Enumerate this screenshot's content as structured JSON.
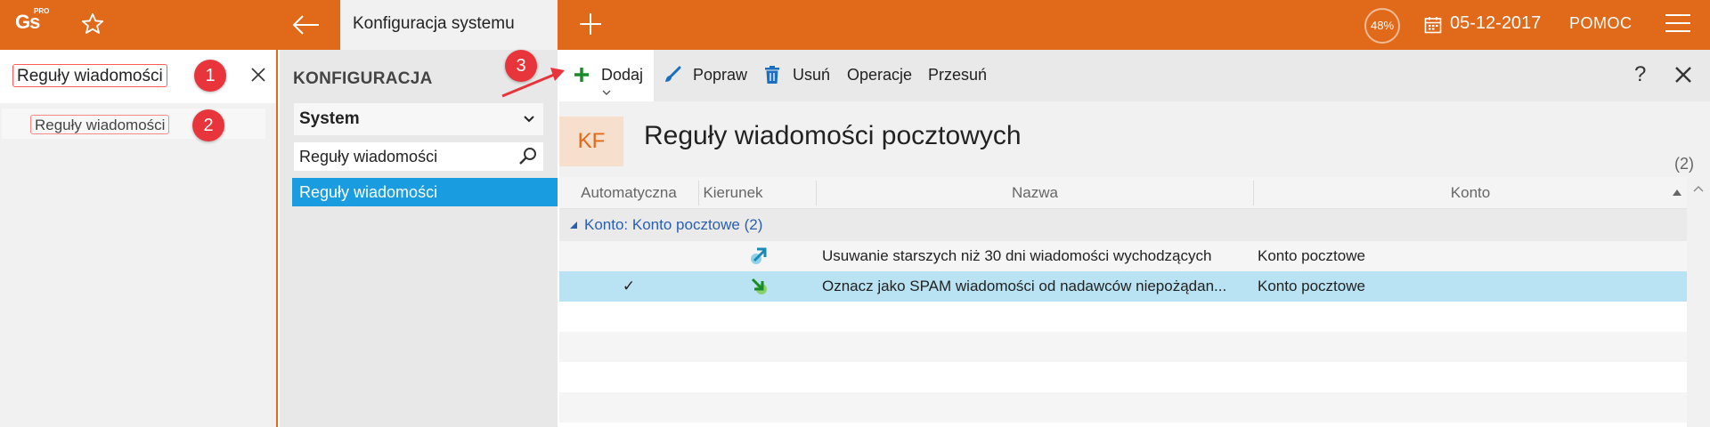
{
  "app": {
    "logo": "Gs",
    "logo_sup": "PRO"
  },
  "topbar": {
    "active_tab": "Konfiguracja systemu",
    "progress": "48%",
    "progress_value": 48,
    "date": "05-12-2017",
    "help": "POMOC"
  },
  "search_panel": {
    "query": "Reguły wiadomości",
    "results": [
      "Reguły wiadomości"
    ]
  },
  "markers": [
    "1",
    "2",
    "3"
  ],
  "config_panel": {
    "title": "KONFIGURACJA",
    "dropdown": "System",
    "filter": "Reguły wiadomości",
    "selected_item": "Reguły wiadomości"
  },
  "toolbar": {
    "add": "Dodaj",
    "edit": "Popraw",
    "delete": "Usuń",
    "operations": "Operacje",
    "move": "Przesuń",
    "help": "?"
  },
  "page": {
    "badge": "KF",
    "title": "Reguły wiadomości pocztowych",
    "count": "(2)"
  },
  "table": {
    "columns": [
      "Automatyczna",
      "Kierunek",
      "Nazwa",
      "Konto"
    ],
    "group": {
      "label": "Konto:",
      "value": "Konto pocztowe (2)"
    },
    "rows": [
      {
        "automatic": "",
        "direction_icon": "outgoing-arrow-icon",
        "name": "Usuwanie starszych niż 30 dni wiadomości wychodzących",
        "account": "Konto pocztowe"
      },
      {
        "automatic": "✓",
        "direction_icon": "incoming-arrow-icon",
        "name": "Oznacz jako SPAM wiadomości od nadawców niepożądan...",
        "account": "Konto pocztowe"
      }
    ]
  },
  "colors": {
    "accent": "#e0691a",
    "selected": "#1a9de0",
    "row_selected": "#b9e3f3",
    "marker": "#e8343b"
  }
}
